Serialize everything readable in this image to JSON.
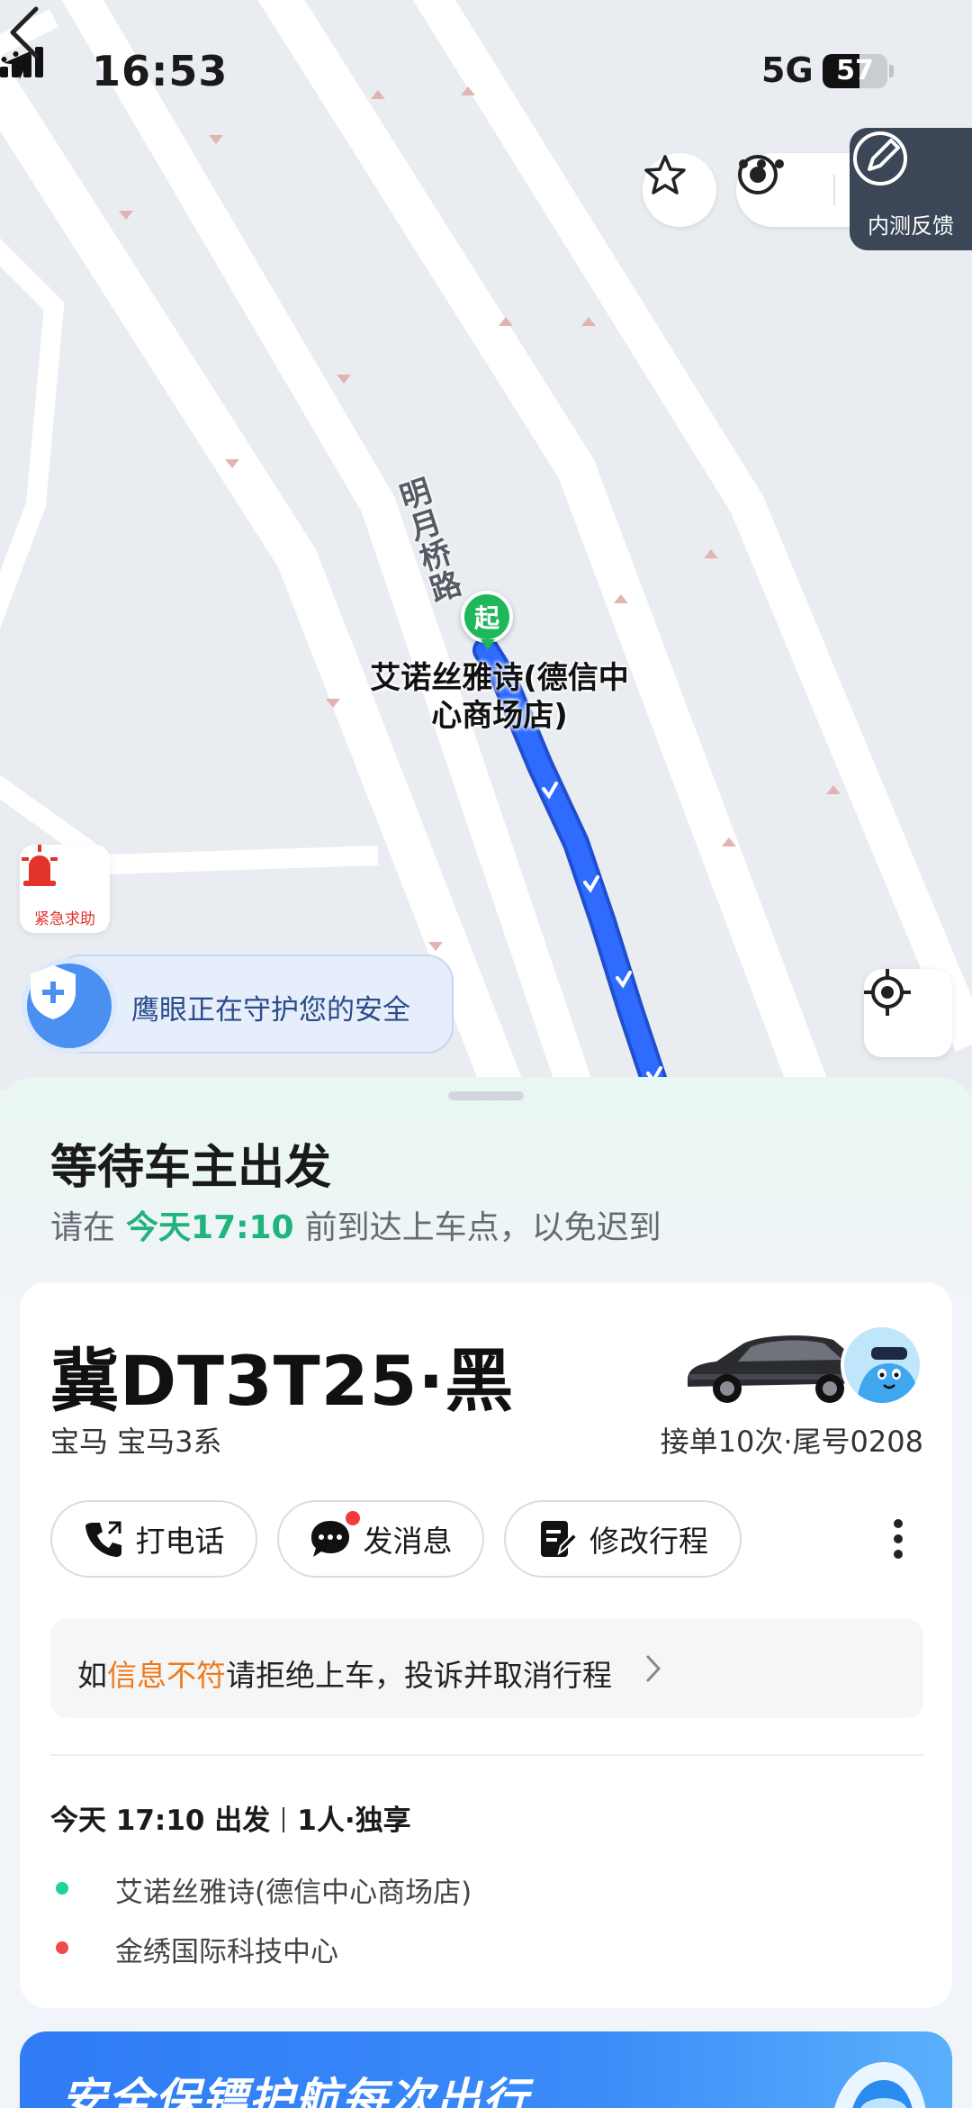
{
  "status_bar": {
    "time": "16:53",
    "network": "5G",
    "battery": "57",
    "battery_level": 0.57
  },
  "nav": {
    "feedback_label": "内测反馈"
  },
  "map": {
    "road_name": "明月桥路",
    "start_pin_label": "起",
    "poi_label": "艾诺丝雅诗(德信中心商场店)",
    "sos_label": "紧急求助",
    "guard_text": "鹰眼正在守护您的安全"
  },
  "sheet": {
    "title": "等待车主出发",
    "subtitle_prefix": "请在",
    "subtitle_time": "今天17:10",
    "subtitle_suffix": "前到达上车点，以免迟到"
  },
  "driver": {
    "plate": "冀DT3T25·黑",
    "car_model": "宝马 宝马3系",
    "stats": "接单10次·尾号0208"
  },
  "actions": {
    "call": "打电话",
    "message": "发消息",
    "edit": "修改行程"
  },
  "notice": {
    "prefix": "如",
    "warn": "信息不符",
    "suffix": "请拒绝上车，投诉并取消行程"
  },
  "trip": {
    "time": "今天 17:10 出发",
    "seats": "1人·独享",
    "from": "艾诺丝雅诗(德信中心商场店)",
    "to": "金绣国际科技中心"
  },
  "banner": {
    "title": "安全保镖护航每次出行"
  },
  "colors": {
    "accent_green": "#1fb37e",
    "route_blue": "#1f5ff2",
    "warn_orange": "#f07a1a",
    "from_dot": "#1fd0a0",
    "to_dot": "#f24a4a"
  }
}
